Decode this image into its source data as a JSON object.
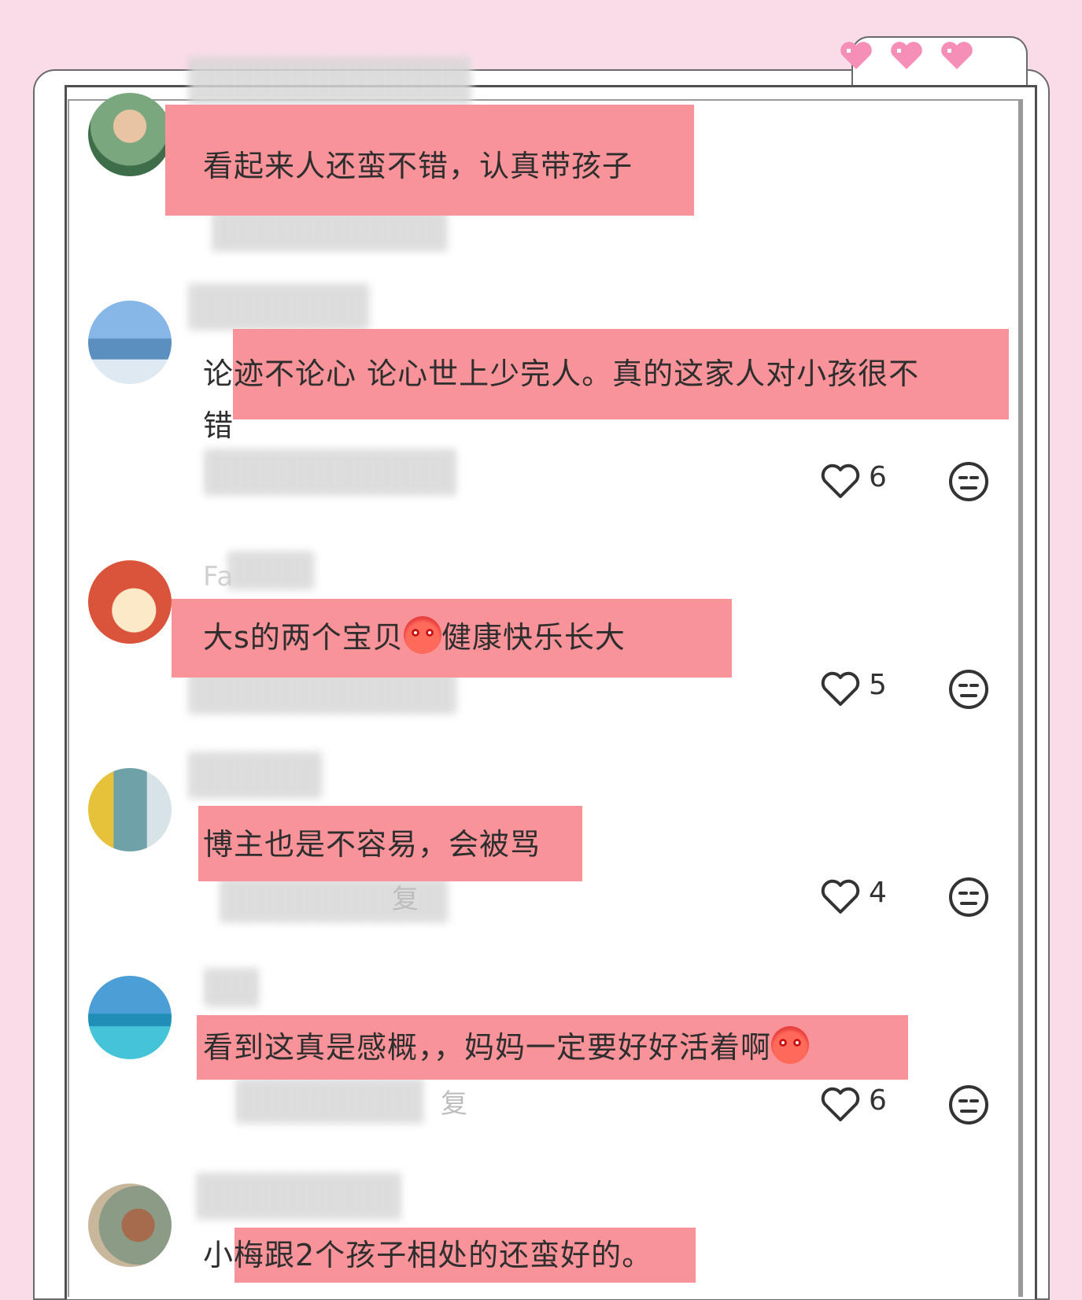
{
  "decor": {
    "hearts": [
      "heart-icon",
      "heart-icon",
      "heart-icon"
    ],
    "accent": "#f8939a",
    "bg": "#fadce8"
  },
  "comments": [
    {
      "text": "看起来人还蛮不错，认真带孩子",
      "likes": "",
      "has_actions": false
    },
    {
      "text_line1": "论迹不论心 论心世上少完人。真的这家人对小孩很不",
      "text_line2": "错",
      "likes": "6",
      "has_actions": true
    },
    {
      "text_before": "大s的两个宝贝",
      "text_after": "健康快乐长大",
      "likes": "5",
      "has_actions": true
    },
    {
      "text": "博主也是不容易，会被骂",
      "likes": "4",
      "has_actions": true
    },
    {
      "text": "看到这真是感概，，妈妈一定要好好活着啊",
      "likes": "6",
      "has_actions": true
    },
    {
      "text": "小梅跟2个孩子相处的还蛮好的。",
      "likes": "",
      "has_actions": false
    }
  ],
  "fragments": {
    "name_c3": "Fa",
    "reply_c4": "复",
    "reply_c5": "复"
  }
}
